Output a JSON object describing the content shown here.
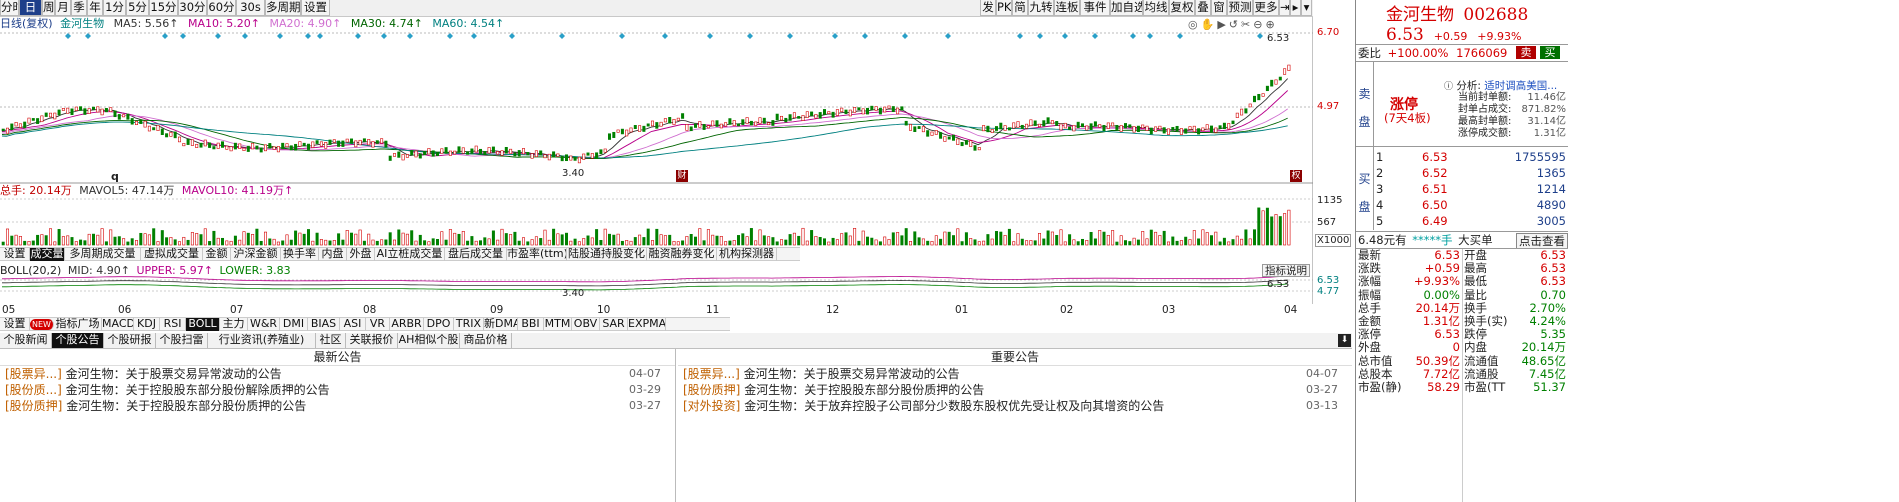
{
  "toolbar": {
    "left": [
      "分时",
      "日",
      "周",
      "月",
      "季",
      "年",
      "1分",
      "5分",
      "15分",
      "30分",
      "60分",
      "30s",
      "多周期",
      "设置"
    ],
    "active": "日",
    "right": [
      "发",
      "PK",
      "简",
      "九转",
      "连板",
      "事件",
      "加自选",
      "均线",
      "复权",
      "叠",
      "窗",
      "预测",
      "更多"
    ]
  },
  "legend": {
    "name": "日线(复权)",
    "stock": "金河生物",
    "ma5": "MA5: 5.56↑",
    "ma10": "MA10: 5.20↑",
    "ma20": "MA20: 4.90↑",
    "ma30": "MA30: 4.74↑",
    "ma60": "MA60: 4.54↑"
  },
  "price_axis": {
    "top": "6.70",
    "mid": "4.97"
  },
  "annotations": {
    "high": "6.53",
    "low": "3.40",
    "marker_cai": "财",
    "marker_right": "权",
    "low_q": "q"
  },
  "volume": {
    "legend_total": "总手: 20.14万",
    "legend_mavol5": "MAVOL5: 47.14万",
    "legend_mavol10": "MAVOL10: 41.19万↑",
    "axis": [
      "1135",
      "567",
      "X1000"
    ]
  },
  "vol_tabs": [
    "设置",
    "成交量",
    "多周期成交量",
    "虚拟成交量",
    "金额",
    "沪深金额",
    "换手率",
    "内盘",
    "外盘",
    "AI立桩成交量",
    "盘后成交量",
    "市盈率(ttm)",
    "陆股通持股变化",
    "融资融券变化",
    "机构探测器"
  ],
  "vol_tab_active": "成交量",
  "boll": {
    "legend": "BOLL(20,2)",
    "mid": "MID: 4.90↑",
    "upper": "UPPER: 5.97↑",
    "lower": "LOWER: 3.83",
    "axis": [
      "6.53",
      "4.77"
    ],
    "help": "指标说明",
    "high": "6.53",
    "low": "3.40"
  },
  "months": [
    "05",
    "06",
    "07",
    "08",
    "09",
    "10",
    "11",
    "12",
    "01",
    "02",
    "03",
    "04"
  ],
  "ind_tabs": [
    "设置",
    "NEW",
    "指标广场",
    "MACD",
    "KDJ",
    "RSI",
    "BOLL",
    "主力",
    "W&R",
    "DMI",
    "BIAS",
    "ASI",
    "VR",
    "ARBR",
    "DPO",
    "TRIX",
    "新DMA",
    "BBI",
    "MTM",
    "OBV",
    "SAR",
    "EXPMA"
  ],
  "ind_tab_active": "BOLL",
  "news_tabs": [
    "个股新闻",
    "个股公告",
    "个股研报",
    "个股扫雷",
    "行业资讯(养殖业)",
    "社区",
    "关联报价",
    "AH相似个股",
    "商品价格"
  ],
  "news_tab_active": "个股公告",
  "news_left": {
    "title": "最新公告",
    "items": [
      {
        "cat": "[股票异...]",
        "text": "金河生物：关于股票交易异常波动的公告",
        "date": "04-07"
      },
      {
        "cat": "[股份质...]",
        "text": "金河生物：关于控股股东部分股份解除质押的公告",
        "date": "03-29"
      },
      {
        "cat": "[股份质押]",
        "text": "金河生物：关于控股股东部分股份质押的公告",
        "date": "03-27"
      }
    ]
  },
  "news_right": {
    "title": "重要公告",
    "items": [
      {
        "cat": "[股票异...]",
        "text": "金河生物：关于股票交易异常波动的公告",
        "date": "04-07"
      },
      {
        "cat": "[股份质押]",
        "text": "金河生物：关于控股股东部分股份质押的公告",
        "date": "03-27"
      },
      {
        "cat": "[对外投资]",
        "text": "金河生物：关于放弃控股子公司部分少数股东股权优先受让权及向其增资的公告",
        "date": "03-13"
      }
    ]
  },
  "panel": {
    "name": "金河生物",
    "code": "002688",
    "price": "6.53",
    "change": "+0.59",
    "pct": "+9.93%",
    "weibi_label": "委比",
    "weibi": "+100.00%",
    "weicha": "1766069",
    "buy": "买",
    "sell": "卖",
    "sell_side": "卖",
    "sell_side2": "盘",
    "limit_status": "涨停",
    "limit_days": "(7天4板)",
    "analysis_label": "分析:",
    "analysis_text": "适时调高美国...",
    "seal": [
      {
        "k": "当前封单额:",
        "v": "11.46亿"
      },
      {
        "k": "封单占成交:",
        "v": "871.82%"
      },
      {
        "k": "最高封单额:",
        "v": "31.14亿"
      },
      {
        "k": "涨停成交额:",
        "v": "1.31亿"
      }
    ],
    "buy_side": "买",
    "buy_side2": "盘",
    "bids": [
      {
        "lv": "1",
        "p": "6.53",
        "v": "1755595"
      },
      {
        "lv": "2",
        "p": "6.52",
        "v": "1365"
      },
      {
        "lv": "3",
        "p": "6.51",
        "v": "1214"
      },
      {
        "lv": "4",
        "p": "6.50",
        "v": "4890"
      },
      {
        "lv": "5",
        "p": "6.49",
        "v": "3005"
      }
    ],
    "big_order": "6.48元有",
    "big_order_hand": "*****手",
    "big_order_label": "大买单",
    "click_view": "点击查看",
    "stats": [
      [
        "最新",
        "6.53",
        "red",
        "开盘",
        "6.53",
        "red"
      ],
      [
        "涨跌",
        "+0.59",
        "red",
        "最高",
        "6.53",
        "red"
      ],
      [
        "涨幅",
        "+9.93%",
        "red",
        "最低",
        "6.53",
        "red"
      ],
      [
        "振幅",
        "0.00%",
        "green",
        "量比",
        "0.70",
        "green"
      ],
      [
        "总手",
        "20.14万",
        "red",
        "换手",
        "2.70%",
        "green"
      ],
      [
        "金额",
        "1.31亿",
        "red",
        "换手(实)",
        "4.24%",
        "green"
      ],
      [
        "涨停",
        "6.53",
        "red",
        "跌停",
        "5.35",
        "green"
      ],
      [
        "外盘",
        "0",
        "red",
        "内盘",
        "20.14万",
        "green"
      ],
      [
        "总市值",
        "50.39亿",
        "red",
        "流通值",
        "48.65亿",
        "green"
      ],
      [
        "总股本",
        "7.72亿",
        "red",
        "流通股",
        "7.45亿",
        "green"
      ],
      [
        "市盈(静)",
        "58.29",
        "red",
        "市盈(TT",
        "51.37",
        "green"
      ]
    ]
  }
}
